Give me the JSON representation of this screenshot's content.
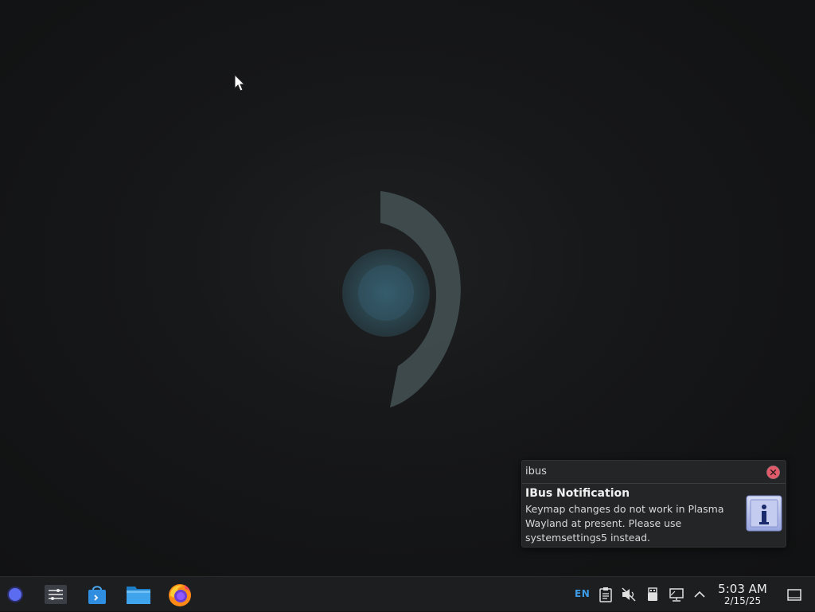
{
  "desktop": {
    "wallpaper": "steam-deck-logo-wallpaper"
  },
  "notification": {
    "app_name": "ibus",
    "title": "IBus Notification",
    "body": "Keymap changes do not work in Plasma Wayland at present. Please use systemsettings5 instead.",
    "icon": "info-icon",
    "close_icon": "close-icon"
  },
  "taskbar": {
    "launchers": [
      {
        "name": "application-launcher",
        "icon": "steamos-logo-icon"
      },
      {
        "name": "task-manager",
        "icon": "sliders-icon"
      },
      {
        "name": "discover",
        "icon": "shopping-bag-icon"
      },
      {
        "name": "file-manager",
        "icon": "folder-icon"
      },
      {
        "name": "firefox",
        "icon": "firefox-icon"
      }
    ],
    "tray": {
      "language": "EN",
      "icons": [
        "clipboard-icon",
        "volume-muted-icon",
        "usb-storage-icon",
        "network-wired-icon",
        "expand-tray-arrow-icon"
      ]
    },
    "clock": {
      "time": "5:03 AM",
      "date": "2/15/25"
    },
    "show_desktop_icon": "show-desktop-icon"
  },
  "colors": {
    "accent": "#3d9be8",
    "panel": "#1c1e20",
    "notification_bg": "#232527",
    "close_red": "#e05a6a"
  }
}
